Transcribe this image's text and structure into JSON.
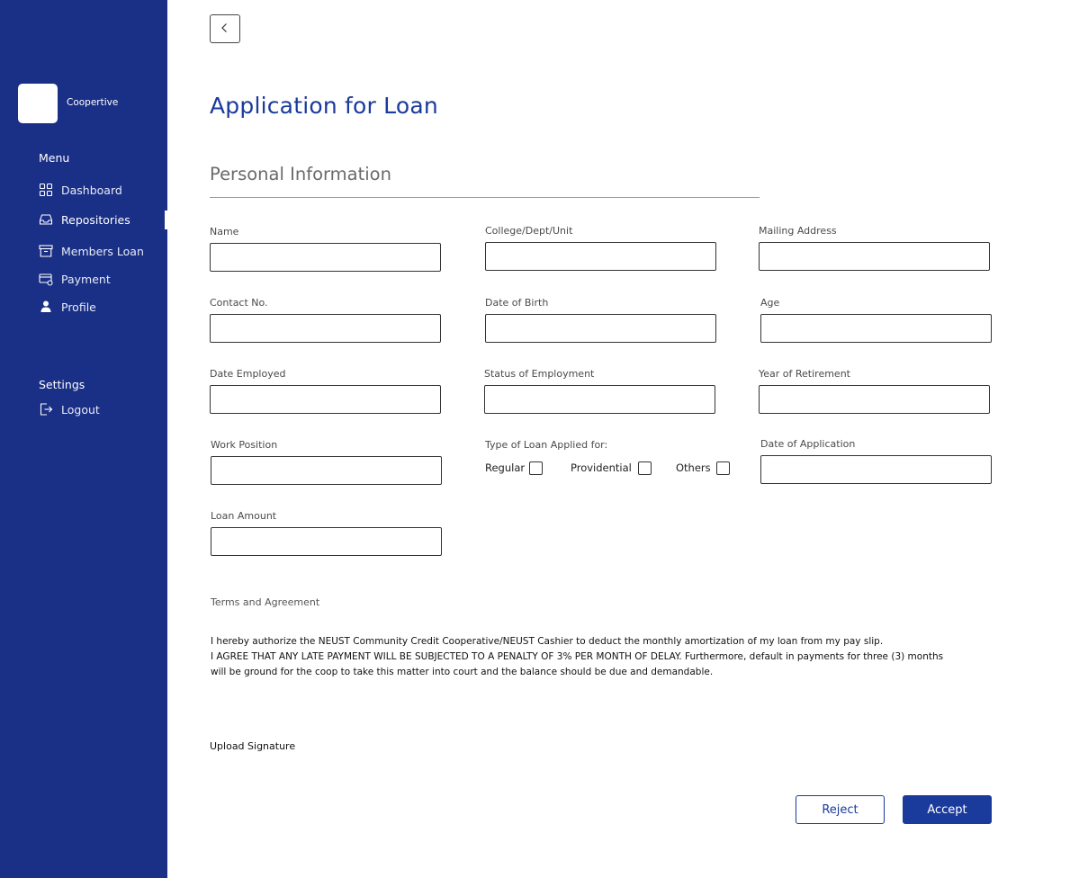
{
  "brand": {
    "name": "Coopertive"
  },
  "sidebar": {
    "menu_title": "Menu",
    "items": [
      {
        "label": "Dashboard",
        "icon": "grid-icon"
      },
      {
        "label": "Repositories",
        "icon": "inbox-icon",
        "active": true
      },
      {
        "label": "Members Loan",
        "icon": "archive-icon"
      },
      {
        "label": "Payment",
        "icon": "payment-icon"
      },
      {
        "label": "Profile",
        "icon": "user-icon"
      }
    ],
    "settings_title": "Settings",
    "logout_label": "Logout"
  },
  "page": {
    "title": "Application for Loan",
    "section_title": "Personal Information"
  },
  "form": {
    "name": {
      "label": "Name",
      "value": ""
    },
    "college": {
      "label": "College/Dept/Unit",
      "value": ""
    },
    "mailing_address": {
      "label": "Mailing Address",
      "value": ""
    },
    "contact_no": {
      "label": "Contact No.",
      "value": ""
    },
    "date_of_birth": {
      "label": "Date of Birth",
      "value": ""
    },
    "age": {
      "label": "Age",
      "value": ""
    },
    "date_employed": {
      "label": "Date Employed",
      "value": ""
    },
    "status_of_employment": {
      "label": "Status of Employment",
      "value": ""
    },
    "year_of_retirement": {
      "label": "Year of Retirement",
      "value": ""
    },
    "work_position": {
      "label": "Work Position",
      "value": ""
    },
    "loan_type": {
      "label": "Type of Loan Applied for:",
      "options": [
        "Regular",
        "Providential",
        "Others"
      ]
    },
    "date_of_application": {
      "label": "Date of Application",
      "value": ""
    },
    "loan_amount": {
      "label": "Loan Amount",
      "value": ""
    }
  },
  "terms": {
    "title": "Terms and Agreement",
    "lines": [
      "I hereby authorize the NEUST Community Credit Cooperative/NEUST Cashier to deduct the monthly amortization of my loan from my pay slip.",
      "I AGREE THAT ANY LATE PAYMENT WILL BE SUBJECTED TO A PENALTY OF 3% PER MONTH OF DELAY. Furthermore, default in payments for three (3) months",
      "will be ground for the coop to take this matter into court and the balance should be due and demandable."
    ]
  },
  "upload_signature_label": "Upload Signature",
  "actions": {
    "reject_label": "Reject",
    "accept_label": "Accept"
  },
  "colors": {
    "sidebar_bg": "#1a2f86",
    "accent": "#1a3a9c"
  }
}
